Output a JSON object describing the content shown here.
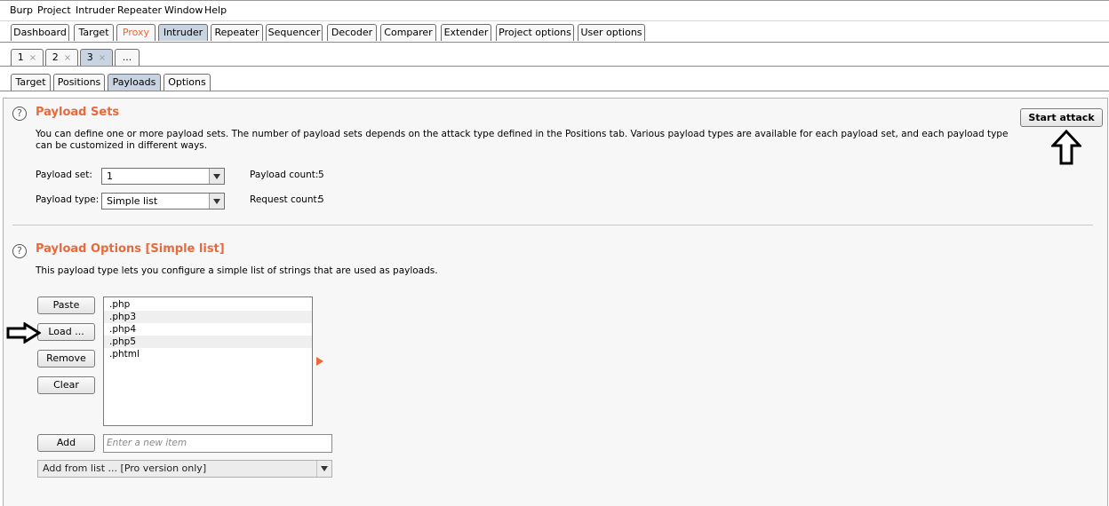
{
  "menu": [
    "Burp",
    "Project",
    "Intruder",
    "Repeater",
    "Window",
    "Help"
  ],
  "main_tabs": [
    "Dashboard",
    "Target",
    "Proxy",
    "Intruder",
    "Repeater",
    "Sequencer",
    "Decoder",
    "Comparer",
    "Extender",
    "Project options",
    "User options"
  ],
  "attack_tabs": [
    {
      "label": "1",
      "close": "×"
    },
    {
      "label": "2",
      "close": "×"
    },
    {
      "label": "3",
      "close": "×"
    },
    {
      "label": "...",
      "close": ""
    }
  ],
  "sub_tabs": [
    "Target",
    "Positions",
    "Payloads",
    "Options"
  ],
  "payload_sets": {
    "title": "Payload Sets",
    "description": "You can define one or more payload sets. The number of payload sets depends on the attack type defined in the Positions tab. Various payload types are available for each payload set, and each payload type can be customized in different ways.",
    "set_label": "Payload set:",
    "set_value": "1",
    "type_label": "Payload type:",
    "type_value": "Simple list",
    "count_label": "Payload count:",
    "count_value": "5",
    "request_label": "Request count:",
    "request_value": "5",
    "start_attack": "Start attack"
  },
  "payload_options": {
    "title": "Payload Options [Simple list]",
    "description": "This payload type lets you configure a simple list of strings that are used as payloads.",
    "buttons": {
      "paste": "Paste",
      "load": "Load ...",
      "remove": "Remove",
      "clear": "Clear",
      "add": "Add"
    },
    "items": [
      ".php",
      ".php3",
      ".php4",
      ".php5",
      ".phtml"
    ],
    "new_item_placeholder": "Enter a new item",
    "add_from_list": "Add from list ... [Pro version only]"
  },
  "help_glyph": "?",
  "colors": {
    "accent": "#e8693b",
    "selected_tab": "#c9d4e2"
  }
}
